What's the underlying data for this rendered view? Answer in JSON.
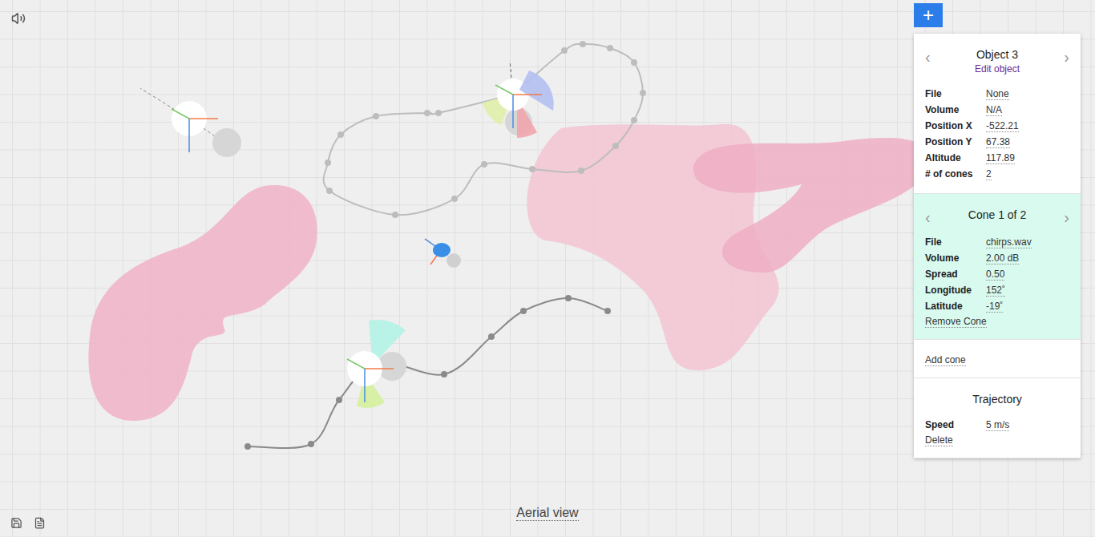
{
  "toolbar": {
    "add_button": "+"
  },
  "canvas": {
    "view_label": "Aerial view"
  },
  "inspector": {
    "prev": "‹",
    "next": "›",
    "title": "Object 3",
    "edit_link": "Edit object",
    "fields": [
      {
        "label": "File",
        "value": "None"
      },
      {
        "label": "Volume",
        "value": "N/A"
      },
      {
        "label": "Position X",
        "value": "-522.21"
      },
      {
        "label": "Position Y",
        "value": "67.38"
      },
      {
        "label": "Altitude",
        "value": "117.89"
      },
      {
        "label": "# of cones",
        "value": "2"
      }
    ],
    "cone": {
      "prev": "‹",
      "next": "›",
      "title": "Cone 1 of 2",
      "fields": [
        {
          "label": "File",
          "value": "chirps.wav"
        },
        {
          "label": "Volume",
          "value": "2.00 dB"
        },
        {
          "label": "Spread",
          "value": "0.50"
        },
        {
          "label": "Longitude",
          "value": "152˚"
        },
        {
          "label": "Latitude",
          "value": "-19˚"
        }
      ],
      "remove": "Remove Cone"
    },
    "add_cone": "Add cone",
    "trajectory": {
      "title": "Trajectory",
      "fields": [
        {
          "label": "Speed",
          "value": "5 m/s"
        }
      ],
      "delete": "Delete"
    }
  }
}
